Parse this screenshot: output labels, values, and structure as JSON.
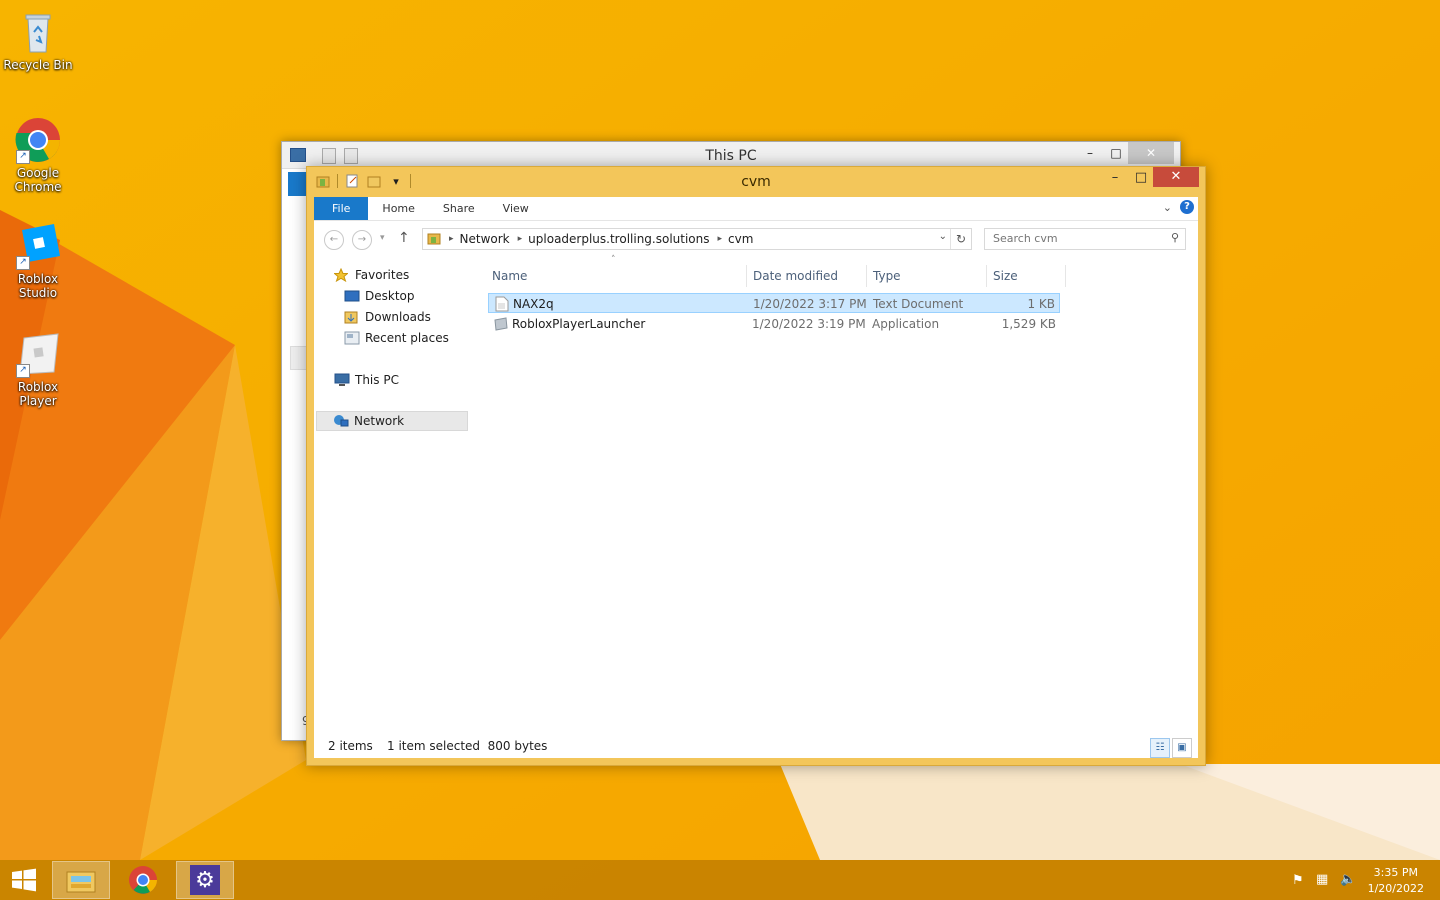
{
  "desktop": {
    "icons": [
      {
        "label": "Recycle Bin"
      },
      {
        "label": "Google Chrome"
      },
      {
        "label": "Roblox Studio"
      },
      {
        "label": "Roblox Player"
      }
    ]
  },
  "back_window": {
    "title": "This PC",
    "minimize": "–",
    "maximize": "□",
    "close": "✕",
    "fragment": "9"
  },
  "window": {
    "title": "cvm",
    "minimize": "–",
    "maximize": "□",
    "close": "✕",
    "ribbon_tabs": [
      "File",
      "Home",
      "Share",
      "View"
    ],
    "help": "?",
    "address": {
      "segments": [
        "Network",
        "uploaderplus.trolling.solutions",
        "cvm"
      ]
    },
    "search": {
      "placeholder": "Search cvm"
    },
    "nav": {
      "favorites": "Favorites",
      "desktop": "Desktop",
      "downloads": "Downloads",
      "recent": "Recent places",
      "this_pc": "This PC",
      "network": "Network"
    },
    "columns": {
      "name": "Name",
      "date": "Date modified",
      "type": "Type",
      "size": "Size"
    },
    "files": [
      {
        "name": "NAX2q",
        "date": "1/20/2022 3:17 PM",
        "type": "Text Document",
        "size": "1 KB"
      },
      {
        "name": "RobloxPlayerLauncher",
        "date": "1/20/2022 3:19 PM",
        "type": "Application",
        "size": "1,529 KB"
      }
    ],
    "status": {
      "count": "2 items",
      "selected": "1 item selected  800 bytes"
    }
  },
  "taskbar": {
    "time": "3:35 PM",
    "date": "1/20/2022"
  },
  "colors": {
    "accent": "#1979ca",
    "window_frame": "#f3c65a",
    "close_red": "#c74b3b",
    "selection": "#cce8ff"
  }
}
